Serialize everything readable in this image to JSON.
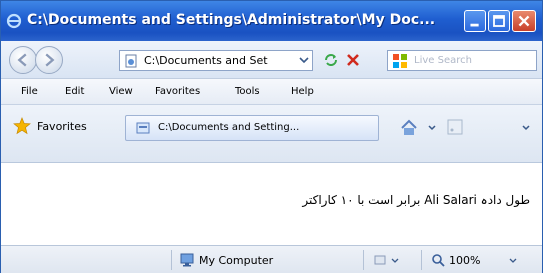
{
  "window": {
    "title": "C:\\Documents and Settings\\Administrator\\My Doc..."
  },
  "address_bar": {
    "value": "C:\\Documents and Set",
    "search_placeholder": "Live Search"
  },
  "menu": {
    "items": [
      "File",
      "Edit",
      "View",
      "Favorites",
      "Tools",
      "Help"
    ]
  },
  "favorites_bar": {
    "favorites_label": "Favorites",
    "tab_title": "C:\\Documents and Setting..."
  },
  "content": {
    "text": "طول دادہ Ali Salari برابر است با ۱۰ کاراکتر"
  },
  "status_bar": {
    "zone": "My Computer",
    "zoom": "100%"
  },
  "colors": {
    "titlebar": "#1f5ed0",
    "close_button": "#c8402a"
  },
  "icons": [
    "ie-icon",
    "back-icon",
    "forward-icon",
    "page-icon",
    "refresh-icon",
    "stop-icon",
    "live-search-icon",
    "favorites-star-icon",
    "home-icon",
    "feed-icon",
    "computer-icon",
    "protected-mode-icon",
    "zoom-icon"
  ]
}
